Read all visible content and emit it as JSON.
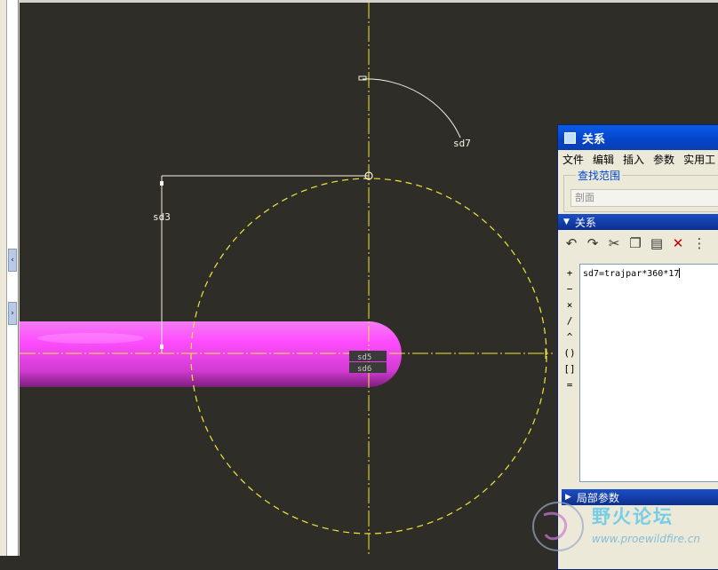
{
  "sketch": {
    "dim_labels": {
      "sd3": "sd3",
      "sd7": "sd7",
      "sd5": "sd5",
      "sd6": "sd6"
    }
  },
  "dialog": {
    "title": "关系",
    "menu": [
      "文件",
      "编辑",
      "插入",
      "参数",
      "实用工"
    ],
    "scope_legend": "查找范围",
    "scope_value": "剖面",
    "section_label": "关系",
    "toolbar": [
      "undo-icon",
      "redo-icon",
      "cut-icon",
      "copy-icon",
      "paste-icon",
      "delete-icon",
      "more-icon"
    ],
    "operators": [
      "+",
      "−",
      "×",
      "/",
      "^",
      "()",
      "[]",
      "="
    ],
    "relation_text": "sd7=trajpar*360*17",
    "local_params_label": "局部参数"
  },
  "watermark": {
    "text": "野火论坛",
    "url": "www.proewildfire.cn"
  },
  "colors": {
    "canvas_bg": "#2f2d28",
    "sketch_yellow": "#f2e838",
    "sketch_white": "#f4f4e0",
    "tube_magenta": "#e040e0",
    "title_blue": "#0a5ce8"
  }
}
